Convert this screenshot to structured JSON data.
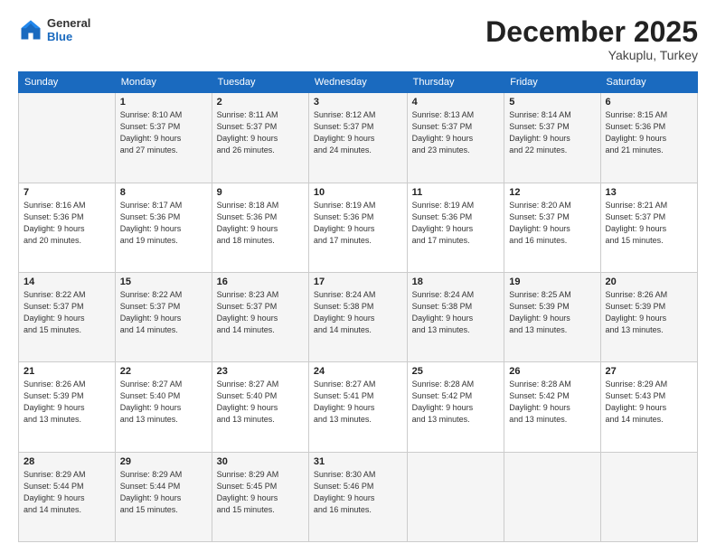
{
  "header": {
    "logo": {
      "general": "General",
      "blue": "Blue"
    },
    "title": "December 2025",
    "location": "Yakuplu, Turkey"
  },
  "days_of_week": [
    "Sunday",
    "Monday",
    "Tuesday",
    "Wednesday",
    "Thursday",
    "Friday",
    "Saturday"
  ],
  "weeks": [
    [
      {
        "day": "",
        "sunrise": "",
        "sunset": "",
        "daylight": ""
      },
      {
        "day": "1",
        "sunrise": "Sunrise: 8:10 AM",
        "sunset": "Sunset: 5:37 PM",
        "daylight": "Daylight: 9 hours and 27 minutes."
      },
      {
        "day": "2",
        "sunrise": "Sunrise: 8:11 AM",
        "sunset": "Sunset: 5:37 PM",
        "daylight": "Daylight: 9 hours and 26 minutes."
      },
      {
        "day": "3",
        "sunrise": "Sunrise: 8:12 AM",
        "sunset": "Sunset: 5:37 PM",
        "daylight": "Daylight: 9 hours and 24 minutes."
      },
      {
        "day": "4",
        "sunrise": "Sunrise: 8:13 AM",
        "sunset": "Sunset: 5:37 PM",
        "daylight": "Daylight: 9 hours and 23 minutes."
      },
      {
        "day": "5",
        "sunrise": "Sunrise: 8:14 AM",
        "sunset": "Sunset: 5:37 PM",
        "daylight": "Daylight: 9 hours and 22 minutes."
      },
      {
        "day": "6",
        "sunrise": "Sunrise: 8:15 AM",
        "sunset": "Sunset: 5:36 PM",
        "daylight": "Daylight: 9 hours and 21 minutes."
      }
    ],
    [
      {
        "day": "7",
        "sunrise": "Sunrise: 8:16 AM",
        "sunset": "Sunset: 5:36 PM",
        "daylight": "Daylight: 9 hours and 20 minutes."
      },
      {
        "day": "8",
        "sunrise": "Sunrise: 8:17 AM",
        "sunset": "Sunset: 5:36 PM",
        "daylight": "Daylight: 9 hours and 19 minutes."
      },
      {
        "day": "9",
        "sunrise": "Sunrise: 8:18 AM",
        "sunset": "Sunset: 5:36 PM",
        "daylight": "Daylight: 9 hours and 18 minutes."
      },
      {
        "day": "10",
        "sunrise": "Sunrise: 8:19 AM",
        "sunset": "Sunset: 5:36 PM",
        "daylight": "Daylight: 9 hours and 17 minutes."
      },
      {
        "day": "11",
        "sunrise": "Sunrise: 8:19 AM",
        "sunset": "Sunset: 5:36 PM",
        "daylight": "Daylight: 9 hours and 17 minutes."
      },
      {
        "day": "12",
        "sunrise": "Sunrise: 8:20 AM",
        "sunset": "Sunset: 5:37 PM",
        "daylight": "Daylight: 9 hours and 16 minutes."
      },
      {
        "day": "13",
        "sunrise": "Sunrise: 8:21 AM",
        "sunset": "Sunset: 5:37 PM",
        "daylight": "Daylight: 9 hours and 15 minutes."
      }
    ],
    [
      {
        "day": "14",
        "sunrise": "Sunrise: 8:22 AM",
        "sunset": "Sunset: 5:37 PM",
        "daylight": "Daylight: 9 hours and 15 minutes."
      },
      {
        "day": "15",
        "sunrise": "Sunrise: 8:22 AM",
        "sunset": "Sunset: 5:37 PM",
        "daylight": "Daylight: 9 hours and 14 minutes."
      },
      {
        "day": "16",
        "sunrise": "Sunrise: 8:23 AM",
        "sunset": "Sunset: 5:37 PM",
        "daylight": "Daylight: 9 hours and 14 minutes."
      },
      {
        "day": "17",
        "sunrise": "Sunrise: 8:24 AM",
        "sunset": "Sunset: 5:38 PM",
        "daylight": "Daylight: 9 hours and 14 minutes."
      },
      {
        "day": "18",
        "sunrise": "Sunrise: 8:24 AM",
        "sunset": "Sunset: 5:38 PM",
        "daylight": "Daylight: 9 hours and 13 minutes."
      },
      {
        "day": "19",
        "sunrise": "Sunrise: 8:25 AM",
        "sunset": "Sunset: 5:39 PM",
        "daylight": "Daylight: 9 hours and 13 minutes."
      },
      {
        "day": "20",
        "sunrise": "Sunrise: 8:26 AM",
        "sunset": "Sunset: 5:39 PM",
        "daylight": "Daylight: 9 hours and 13 minutes."
      }
    ],
    [
      {
        "day": "21",
        "sunrise": "Sunrise: 8:26 AM",
        "sunset": "Sunset: 5:39 PM",
        "daylight": "Daylight: 9 hours and 13 minutes."
      },
      {
        "day": "22",
        "sunrise": "Sunrise: 8:27 AM",
        "sunset": "Sunset: 5:40 PM",
        "daylight": "Daylight: 9 hours and 13 minutes."
      },
      {
        "day": "23",
        "sunrise": "Sunrise: 8:27 AM",
        "sunset": "Sunset: 5:40 PM",
        "daylight": "Daylight: 9 hours and 13 minutes."
      },
      {
        "day": "24",
        "sunrise": "Sunrise: 8:27 AM",
        "sunset": "Sunset: 5:41 PM",
        "daylight": "Daylight: 9 hours and 13 minutes."
      },
      {
        "day": "25",
        "sunrise": "Sunrise: 8:28 AM",
        "sunset": "Sunset: 5:42 PM",
        "daylight": "Daylight: 9 hours and 13 minutes."
      },
      {
        "day": "26",
        "sunrise": "Sunrise: 8:28 AM",
        "sunset": "Sunset: 5:42 PM",
        "daylight": "Daylight: 9 hours and 13 minutes."
      },
      {
        "day": "27",
        "sunrise": "Sunrise: 8:29 AM",
        "sunset": "Sunset: 5:43 PM",
        "daylight": "Daylight: 9 hours and 14 minutes."
      }
    ],
    [
      {
        "day": "28",
        "sunrise": "Sunrise: 8:29 AM",
        "sunset": "Sunset: 5:44 PM",
        "daylight": "Daylight: 9 hours and 14 minutes."
      },
      {
        "day": "29",
        "sunrise": "Sunrise: 8:29 AM",
        "sunset": "Sunset: 5:44 PM",
        "daylight": "Daylight: 9 hours and 15 minutes."
      },
      {
        "day": "30",
        "sunrise": "Sunrise: 8:29 AM",
        "sunset": "Sunset: 5:45 PM",
        "daylight": "Daylight: 9 hours and 15 minutes."
      },
      {
        "day": "31",
        "sunrise": "Sunrise: 8:30 AM",
        "sunset": "Sunset: 5:46 PM",
        "daylight": "Daylight: 9 hours and 16 minutes."
      },
      {
        "day": "",
        "sunrise": "",
        "sunset": "",
        "daylight": ""
      },
      {
        "day": "",
        "sunrise": "",
        "sunset": "",
        "daylight": ""
      },
      {
        "day": "",
        "sunrise": "",
        "sunset": "",
        "daylight": ""
      }
    ]
  ]
}
